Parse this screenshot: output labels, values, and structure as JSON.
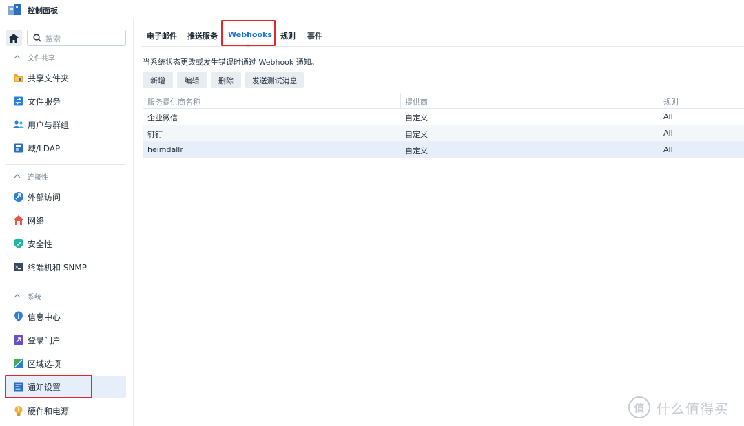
{
  "window": {
    "title": "控制面板",
    "icon": "control-panel-icon"
  },
  "sidebar": {
    "search_placeholder": "搜索",
    "sections": [
      {
        "title": "文件共享",
        "items": [
          {
            "label": "共享文件夹",
            "icon": "shared-folder-icon"
          },
          {
            "label": "文件服务",
            "icon": "file-services-icon"
          },
          {
            "label": "用户与群组",
            "icon": "users-groups-icon"
          },
          {
            "label": "域/LDAP",
            "icon": "domain-ldap-icon"
          }
        ]
      },
      {
        "title": "连接性",
        "items": [
          {
            "label": "外部访问",
            "icon": "external-access-icon"
          },
          {
            "label": "网络",
            "icon": "network-icon"
          },
          {
            "label": "安全性",
            "icon": "security-shield-icon"
          },
          {
            "label": "终端机和 SNMP",
            "icon": "terminal-icon"
          }
        ]
      },
      {
        "title": "系统",
        "items": [
          {
            "label": "信息中心",
            "icon": "info-center-icon"
          },
          {
            "label": "登录门户",
            "icon": "login-portal-icon"
          },
          {
            "label": "区域选项",
            "icon": "regional-options-icon"
          },
          {
            "label": "通知设置",
            "icon": "notification-icon",
            "active": true
          },
          {
            "label": "硬件和电源",
            "icon": "hardware-power-icon"
          }
        ]
      }
    ]
  },
  "tabs": [
    {
      "label": "电子邮件"
    },
    {
      "label": "推送服务"
    },
    {
      "label": "Webhooks",
      "active": true
    },
    {
      "label": "规则"
    },
    {
      "label": "事件"
    }
  ],
  "description": "当系统状态更改或发生错误时通过 Webhook 通知。",
  "toolbar": {
    "add_label": "新增",
    "edit_label": "编辑",
    "delete_label": "删除",
    "test_label": "发送测试消息"
  },
  "table": {
    "columns": [
      "服务提供商名称",
      "提供商",
      "规则"
    ],
    "rows": [
      [
        "企业微信",
        "自定义",
        "All"
      ],
      [
        "钉钉",
        "自定义",
        "All"
      ],
      [
        "heimdallr",
        "自定义",
        "All"
      ]
    ]
  },
  "watermark": {
    "logo_text": "值",
    "text": "什么值得买"
  },
  "colors": {
    "accent": "#1a73d9",
    "highlight_box": "#e5262b",
    "active_bg": "#e5eef9"
  }
}
